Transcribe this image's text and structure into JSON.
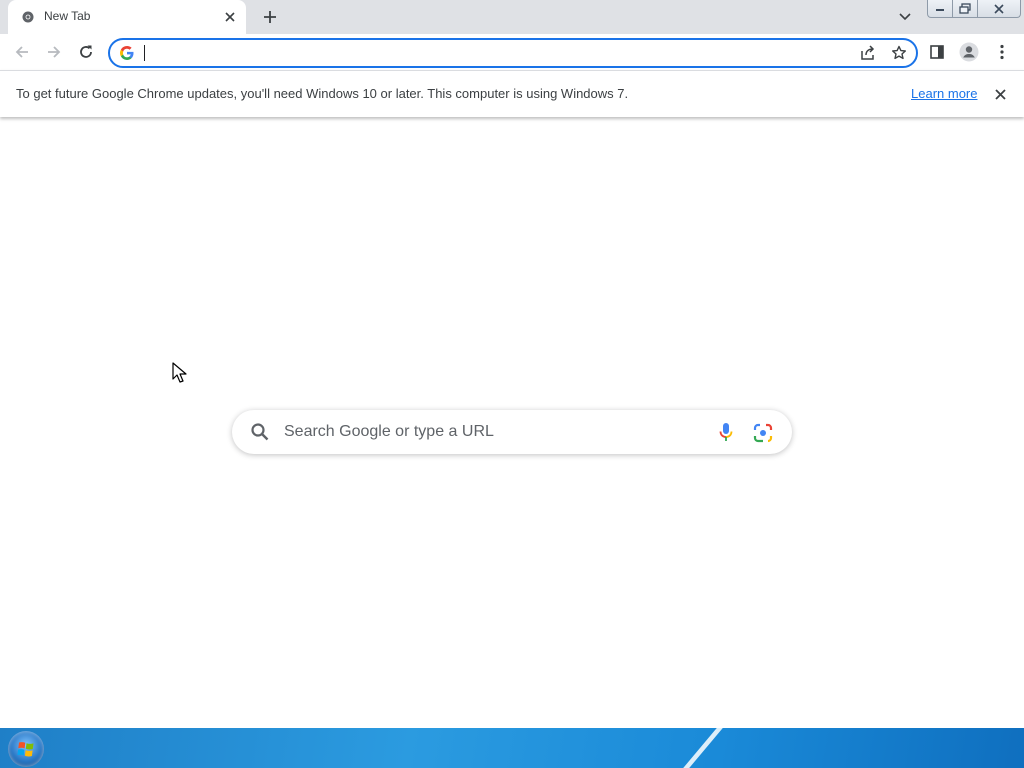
{
  "tab": {
    "title": "New Tab",
    "favicon": "chrome-icon"
  },
  "tabstrip": {
    "new_tab_icon": "plus-icon",
    "tab_search_icon": "chevron-down-icon"
  },
  "window_controls": {
    "minimize_icon": "minimize-icon",
    "restore_icon": "restore-icon",
    "close_icon": "close-icon"
  },
  "toolbar": {
    "back_icon": "arrow-left-icon",
    "forward_icon": "arrow-right-icon",
    "reload_icon": "reload-icon",
    "omnibox": {
      "value": "",
      "provider_icon": "google-g-icon",
      "share_icon": "share-icon",
      "bookmark_icon": "star-icon"
    },
    "side_panel_icon": "side-panel-icon",
    "profile_icon": "person-icon",
    "menu_icon": "kebab-menu-icon"
  },
  "infobar": {
    "message": "To get future Google Chrome updates, you'll need Windows 10 or later. This computer is using Windows 7.",
    "link": "Learn more",
    "close_icon": "close-icon"
  },
  "ntp": {
    "search_placeholder": "Search Google or type a URL",
    "search_icon": "search-icon",
    "voice_icon": "microphone-icon",
    "lens_icon": "google-lens-icon"
  },
  "taskbar": {
    "start_icon": "windows-start-orb-icon"
  },
  "colors": {
    "accent": "#1a73e8",
    "tabstrip_bg": "#dfe1e5",
    "taskbar": "#1f7fc7"
  }
}
